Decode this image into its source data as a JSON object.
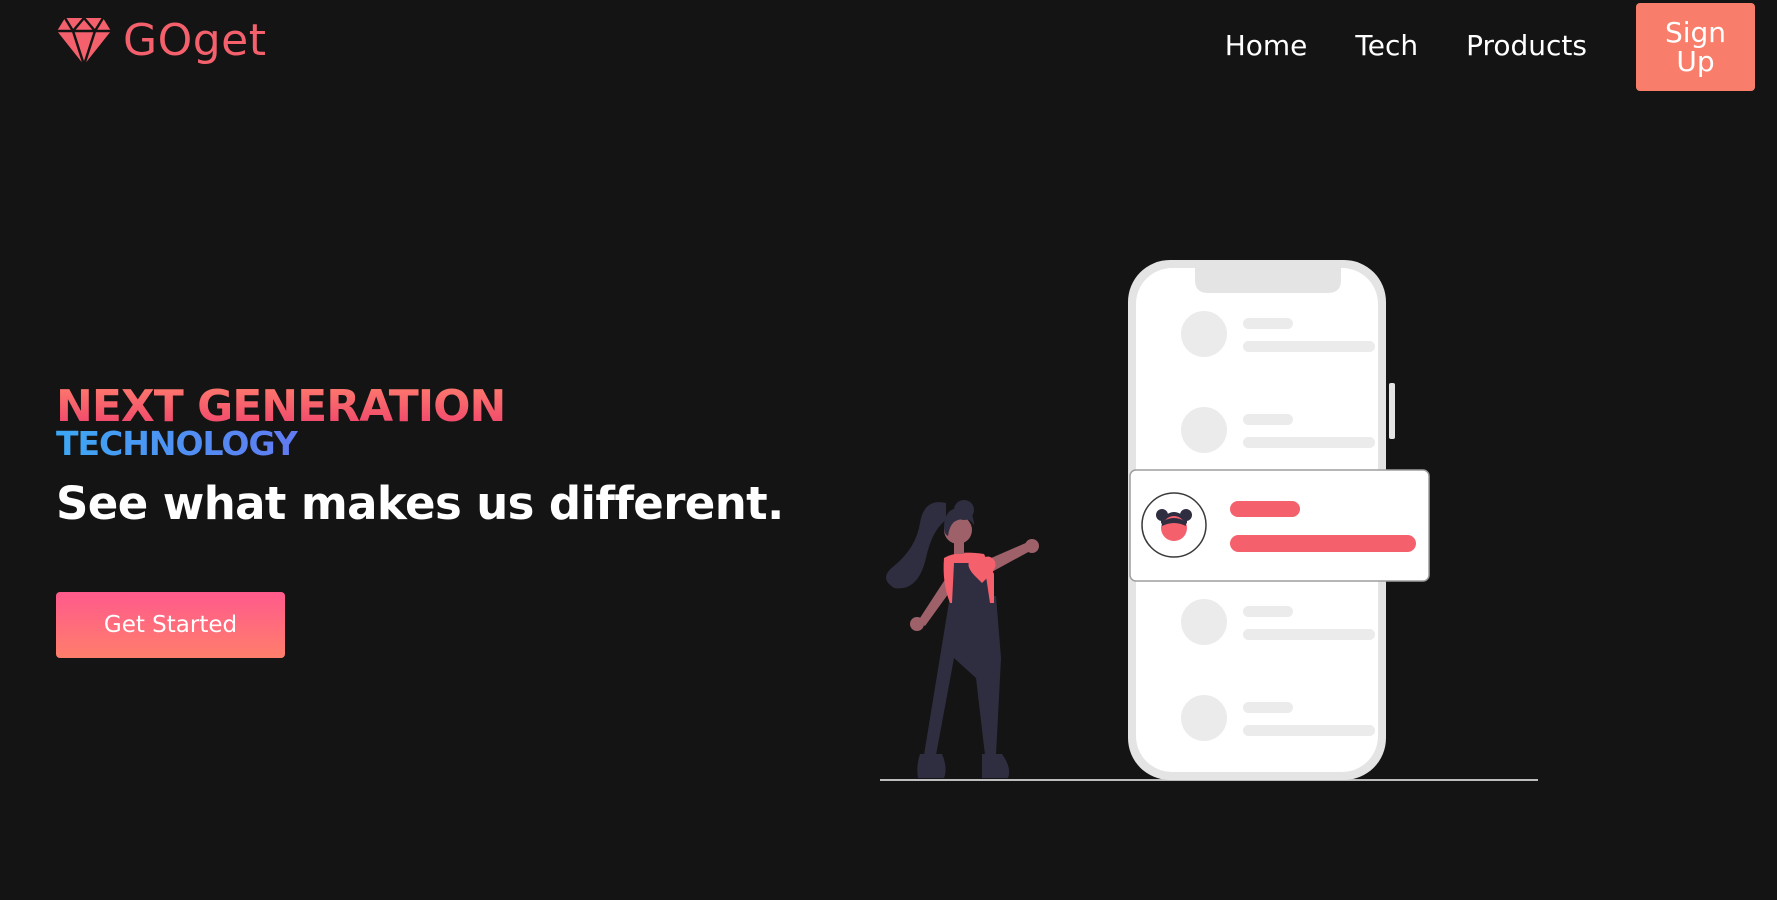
{
  "brand": {
    "name": "GOget",
    "icon": "diamond-icon",
    "color": "#f4606c"
  },
  "nav": {
    "links": [
      {
        "label": "Home"
      },
      {
        "label": "Tech"
      },
      {
        "label": "Products"
      }
    ],
    "signup_label": "Sign Up",
    "signup_color": "#f97d6b"
  },
  "hero": {
    "headline_line1": "NEXT GENERATION",
    "headline_line2": "TECHNOLOGY",
    "tagline": "See what makes us different.",
    "cta_label": "Get Started"
  },
  "colors": {
    "background": "#141414",
    "accent_pink": "#f4606c",
    "accent_coral": "#f97d6b",
    "accent_blue": "#3ca8f4",
    "accent_purple": "#9b4fe8"
  },
  "illustration": {
    "icon": "phone-with-woman-illustration",
    "phone_icon": "smartphone-icon",
    "avatar_icon": "avatar-icon",
    "person_icon": "woman-pointing-icon"
  }
}
